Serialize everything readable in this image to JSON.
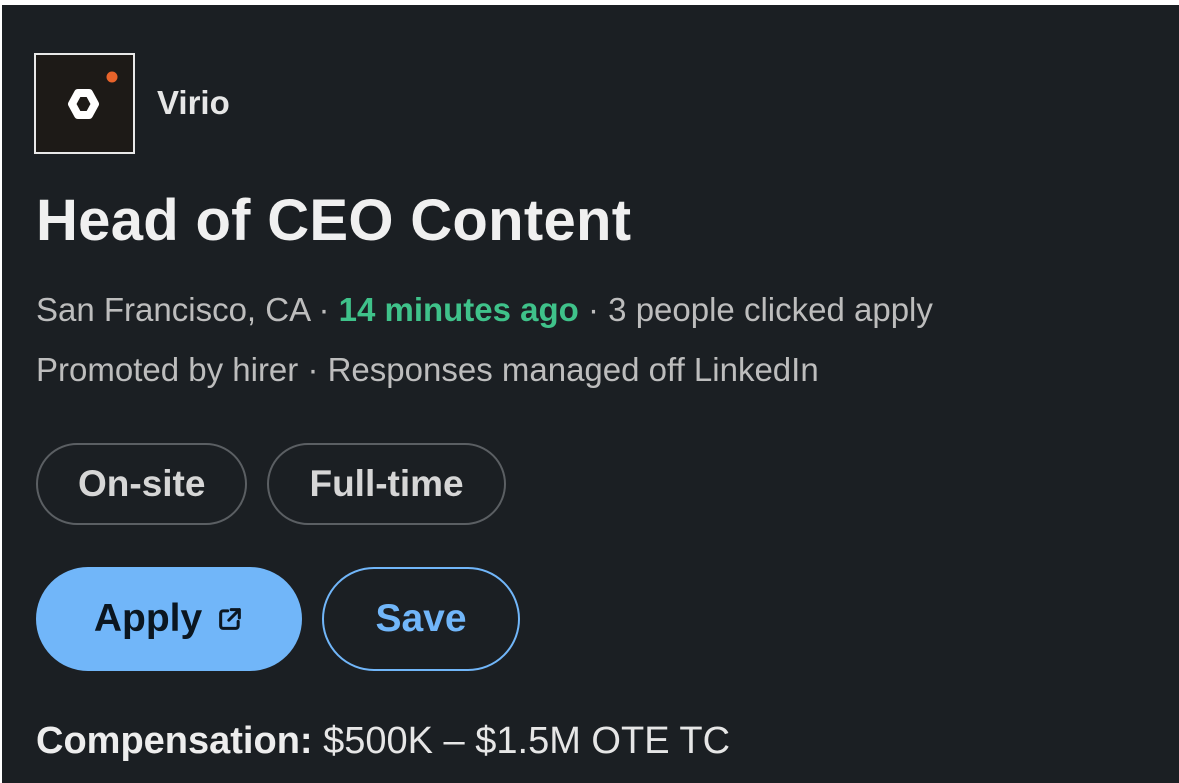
{
  "company": {
    "name": "Virio",
    "logo_icon": "virio-logo-icon",
    "logo_accent": "#e8632a"
  },
  "job": {
    "title": "Head of CEO Content",
    "location": "San Francisco, CA",
    "sep1": " · ",
    "posted": "14 minutes ago",
    "sep2": " · ",
    "applicants": "3 people clicked apply",
    "promoted_line": "Promoted by hirer · Responses managed off LinkedIn"
  },
  "chips": [
    "On-site",
    "Full-time"
  ],
  "actions": {
    "apply_label": "Apply",
    "apply_icon": "external-link-icon",
    "save_label": "Save"
  },
  "compensation": {
    "label": "Compensation:",
    "value": " $500K – $1.5M OTE TC"
  },
  "colors": {
    "background": "#1b1f23",
    "accent_blue": "#71b6f9",
    "posted_green": "#3fc28a"
  }
}
